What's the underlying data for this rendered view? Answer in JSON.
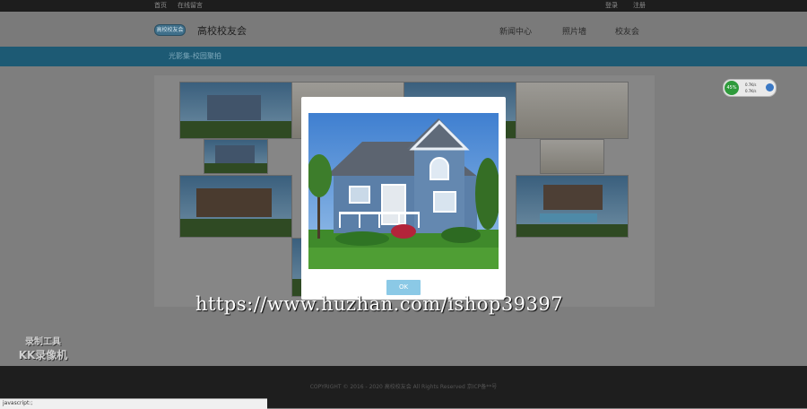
{
  "topbar": {
    "left_links": [
      "首页",
      "在线留言"
    ],
    "right_links": [
      "登录",
      "注册"
    ]
  },
  "header": {
    "logo_badge": "高校校友会",
    "site_title": "高校校友会",
    "nav": [
      "新闻中心",
      "照片墙",
      "校友会"
    ]
  },
  "banner": {
    "breadcrumb": "光影集-校园聚拍"
  },
  "modal": {
    "ok_label": "OK"
  },
  "widget": {
    "percent": "45%",
    "up_rate": "0.7K/s",
    "down_rate": "0.7K/s"
  },
  "recorder": {
    "line1": "录制工具",
    "line2": "KK录像机"
  },
  "watermark": "https://www.huzhan.com/ishop39397",
  "footer": {
    "copyright": "COPYRIGHT © 2016 - 2020 高校校友会  All Rights Reserved  京ICP备**号"
  },
  "statusbar": {
    "text": "javascript:;"
  },
  "icons": {
    "logo": "logo-icon",
    "recorder": "camera-icon",
    "widget": "network-monitor-icon"
  },
  "colors": {
    "banner": "#1d5a74",
    "ok_button": "#8bc9e6",
    "footer": "#1e1e1e"
  }
}
